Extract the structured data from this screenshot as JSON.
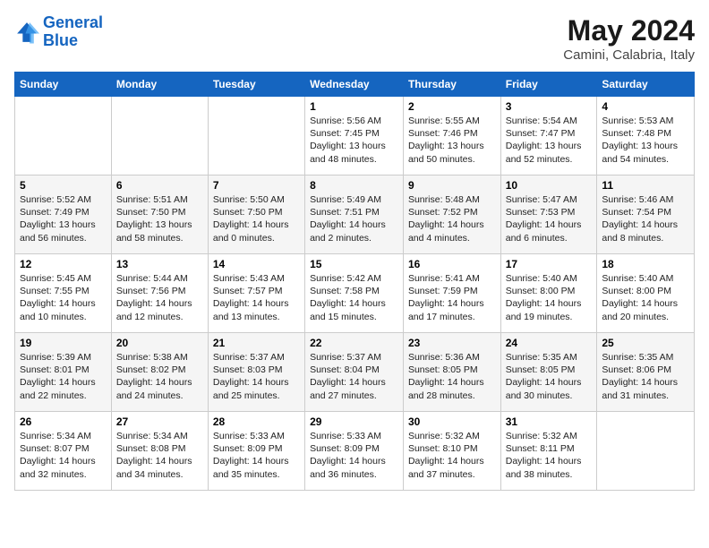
{
  "header": {
    "logo_line1": "General",
    "logo_line2": "Blue",
    "month": "May 2024",
    "location": "Camini, Calabria, Italy"
  },
  "days_of_week": [
    "Sunday",
    "Monday",
    "Tuesday",
    "Wednesday",
    "Thursday",
    "Friday",
    "Saturday"
  ],
  "weeks": [
    [
      {
        "day": "",
        "info": ""
      },
      {
        "day": "",
        "info": ""
      },
      {
        "day": "",
        "info": ""
      },
      {
        "day": "1",
        "info": "Sunrise: 5:56 AM\nSunset: 7:45 PM\nDaylight: 13 hours and 48 minutes."
      },
      {
        "day": "2",
        "info": "Sunrise: 5:55 AM\nSunset: 7:46 PM\nDaylight: 13 hours and 50 minutes."
      },
      {
        "day": "3",
        "info": "Sunrise: 5:54 AM\nSunset: 7:47 PM\nDaylight: 13 hours and 52 minutes."
      },
      {
        "day": "4",
        "info": "Sunrise: 5:53 AM\nSunset: 7:48 PM\nDaylight: 13 hours and 54 minutes."
      }
    ],
    [
      {
        "day": "5",
        "info": "Sunrise: 5:52 AM\nSunset: 7:49 PM\nDaylight: 13 hours and 56 minutes."
      },
      {
        "day": "6",
        "info": "Sunrise: 5:51 AM\nSunset: 7:50 PM\nDaylight: 13 hours and 58 minutes."
      },
      {
        "day": "7",
        "info": "Sunrise: 5:50 AM\nSunset: 7:50 PM\nDaylight: 14 hours and 0 minutes."
      },
      {
        "day": "8",
        "info": "Sunrise: 5:49 AM\nSunset: 7:51 PM\nDaylight: 14 hours and 2 minutes."
      },
      {
        "day": "9",
        "info": "Sunrise: 5:48 AM\nSunset: 7:52 PM\nDaylight: 14 hours and 4 minutes."
      },
      {
        "day": "10",
        "info": "Sunrise: 5:47 AM\nSunset: 7:53 PM\nDaylight: 14 hours and 6 minutes."
      },
      {
        "day": "11",
        "info": "Sunrise: 5:46 AM\nSunset: 7:54 PM\nDaylight: 14 hours and 8 minutes."
      }
    ],
    [
      {
        "day": "12",
        "info": "Sunrise: 5:45 AM\nSunset: 7:55 PM\nDaylight: 14 hours and 10 minutes."
      },
      {
        "day": "13",
        "info": "Sunrise: 5:44 AM\nSunset: 7:56 PM\nDaylight: 14 hours and 12 minutes."
      },
      {
        "day": "14",
        "info": "Sunrise: 5:43 AM\nSunset: 7:57 PM\nDaylight: 14 hours and 13 minutes."
      },
      {
        "day": "15",
        "info": "Sunrise: 5:42 AM\nSunset: 7:58 PM\nDaylight: 14 hours and 15 minutes."
      },
      {
        "day": "16",
        "info": "Sunrise: 5:41 AM\nSunset: 7:59 PM\nDaylight: 14 hours and 17 minutes."
      },
      {
        "day": "17",
        "info": "Sunrise: 5:40 AM\nSunset: 8:00 PM\nDaylight: 14 hours and 19 minutes."
      },
      {
        "day": "18",
        "info": "Sunrise: 5:40 AM\nSunset: 8:00 PM\nDaylight: 14 hours and 20 minutes."
      }
    ],
    [
      {
        "day": "19",
        "info": "Sunrise: 5:39 AM\nSunset: 8:01 PM\nDaylight: 14 hours and 22 minutes."
      },
      {
        "day": "20",
        "info": "Sunrise: 5:38 AM\nSunset: 8:02 PM\nDaylight: 14 hours and 24 minutes."
      },
      {
        "day": "21",
        "info": "Sunrise: 5:37 AM\nSunset: 8:03 PM\nDaylight: 14 hours and 25 minutes."
      },
      {
        "day": "22",
        "info": "Sunrise: 5:37 AM\nSunset: 8:04 PM\nDaylight: 14 hours and 27 minutes."
      },
      {
        "day": "23",
        "info": "Sunrise: 5:36 AM\nSunset: 8:05 PM\nDaylight: 14 hours and 28 minutes."
      },
      {
        "day": "24",
        "info": "Sunrise: 5:35 AM\nSunset: 8:05 PM\nDaylight: 14 hours and 30 minutes."
      },
      {
        "day": "25",
        "info": "Sunrise: 5:35 AM\nSunset: 8:06 PM\nDaylight: 14 hours and 31 minutes."
      }
    ],
    [
      {
        "day": "26",
        "info": "Sunrise: 5:34 AM\nSunset: 8:07 PM\nDaylight: 14 hours and 32 minutes."
      },
      {
        "day": "27",
        "info": "Sunrise: 5:34 AM\nSunset: 8:08 PM\nDaylight: 14 hours and 34 minutes."
      },
      {
        "day": "28",
        "info": "Sunrise: 5:33 AM\nSunset: 8:09 PM\nDaylight: 14 hours and 35 minutes."
      },
      {
        "day": "29",
        "info": "Sunrise: 5:33 AM\nSunset: 8:09 PM\nDaylight: 14 hours and 36 minutes."
      },
      {
        "day": "30",
        "info": "Sunrise: 5:32 AM\nSunset: 8:10 PM\nDaylight: 14 hours and 37 minutes."
      },
      {
        "day": "31",
        "info": "Sunrise: 5:32 AM\nSunset: 8:11 PM\nDaylight: 14 hours and 38 minutes."
      },
      {
        "day": "",
        "info": ""
      }
    ]
  ]
}
